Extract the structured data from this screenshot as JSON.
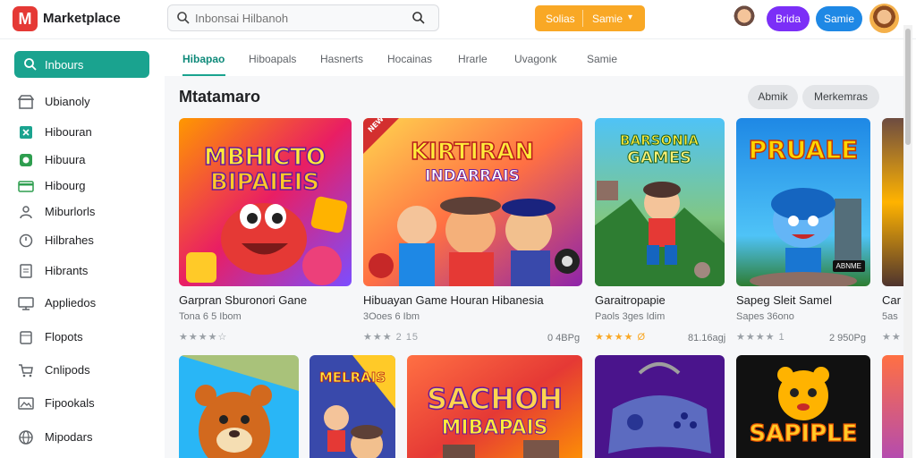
{
  "app": {
    "name": "Marketplace",
    "logo_glyph": "M"
  },
  "search": {
    "placeholder": "Inbonsai Hilbanoh"
  },
  "header": {
    "orange_left": "Solias",
    "orange_right": "Samie",
    "purple_btn": "Brida",
    "blue_btn": "Samie"
  },
  "sidebar": {
    "active": "Inbours",
    "items": [
      {
        "label": "Ubianoly",
        "icon": "store-icon"
      },
      {
        "label": "Hibouran",
        "icon": "puzzle-icon"
      },
      {
        "label": "Hibuura",
        "icon": "leaf-icon"
      },
      {
        "label": "Hibourg",
        "icon": "card-icon"
      },
      {
        "label": "Miburlorls",
        "icon": "people-icon"
      },
      {
        "label": "Hilbrahes",
        "icon": "circle-icon"
      },
      {
        "label": "Hibrants",
        "icon": "document-icon"
      },
      {
        "label": "Appliedos",
        "icon": "monitor-icon"
      },
      {
        "label": "Flopots",
        "icon": "box-icon"
      },
      {
        "label": "Cnlipods",
        "icon": "cart-icon"
      },
      {
        "label": "Fipookals",
        "icon": "image-icon"
      },
      {
        "label": "Mipodars",
        "icon": "globe-icon"
      }
    ]
  },
  "tabs": [
    "Hibapao",
    "Hiboapals",
    "Hasnerts",
    "Hocainas",
    "Hrarle",
    "Uvagonk",
    "Samie"
  ],
  "section": {
    "title": "Mtatamaro",
    "pill_1": "Abmik",
    "pill_2": "Merkemras"
  },
  "games_row1": [
    {
      "title": "Garpran Sburonori Gane",
      "sub": "Tona 6 5 Ibom",
      "rating": "★★★★☆",
      "size": "",
      "art_title_1": "MBHICTO",
      "art_title_2": "BIPAIEIS"
    },
    {
      "title": "Hibuayan Game Houran Hibanesia",
      "sub": "3Ooes 6 Ibm",
      "rating": "★★★ 2 15",
      "size": "0 4BPg",
      "art_title_1": "KIRTIRAN",
      "art_title_2": "INDARRAIS",
      "art_corner": "NEW"
    },
    {
      "title": "Garaitropapie",
      "sub": "Paols 3ges Idim",
      "rating": "★★★★ Ø",
      "size": "81.16agj",
      "art_title_1": "BARSONIA",
      "art_title_2": "GAMES"
    },
    {
      "title": "Sapeg Sleit Samel",
      "sub": "Sapes 36ono",
      "rating": "★★★★ 1",
      "size": "2 950Pg",
      "art_title_1": "PRUALE",
      "art_badge": "ABNME"
    },
    {
      "title": "Car",
      "sub": "5as",
      "rating": "★★",
      "size": ""
    }
  ],
  "games_row2": [
    {
      "art_title_1": ""
    },
    {
      "art_title_1": "MELRAIS"
    },
    {
      "art_title_1": "SACHOH",
      "art_title_2": "MIBAPAIS"
    },
    {
      "art_title_1": ""
    },
    {
      "art_title_1": "SAPIPLE"
    },
    {
      "art_title_1": ""
    }
  ],
  "colors": {
    "accent": "#1aa38f",
    "orange": "#f9a825",
    "purple": "#7b2ff7",
    "blue": "#1e88e5",
    "logo_red": "#e53935"
  }
}
